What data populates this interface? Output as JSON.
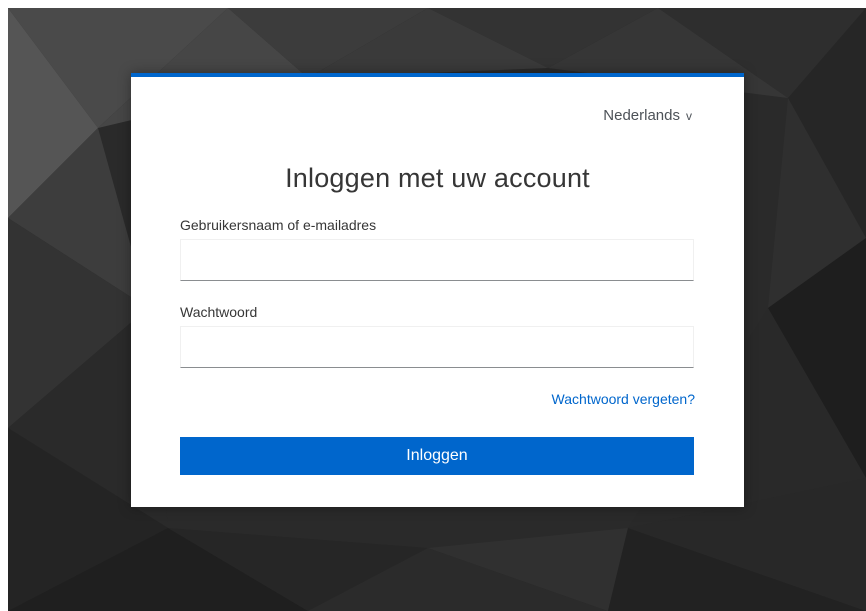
{
  "language_selector": {
    "label": "Nederlands",
    "chevron": "v"
  },
  "login": {
    "title": "Inloggen met uw account",
    "username_label": "Gebruikersnaam of e-mailadres",
    "username_value": "",
    "password_label": "Wachtwoord",
    "password_value": "",
    "forgot_password": "Wachtwoord vergeten?",
    "submit_label": "Inloggen"
  },
  "colors": {
    "accent": "#0066cc",
    "background": "#2a2a2a",
    "card": "#ffffff"
  }
}
